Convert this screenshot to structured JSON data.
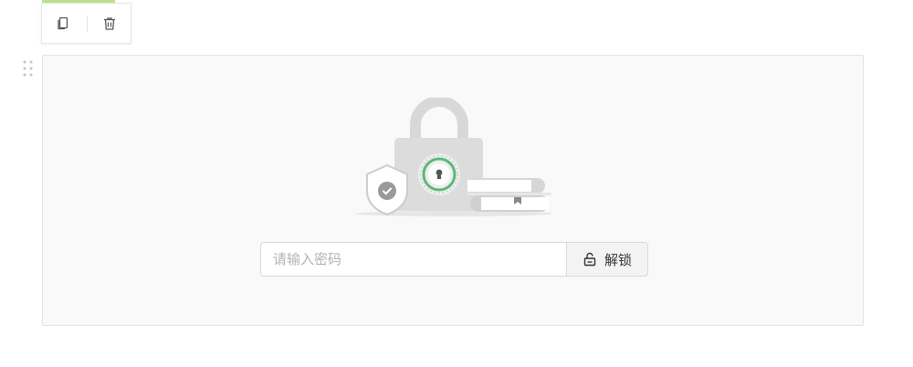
{
  "toolbar": {
    "copy_icon": "copy-icon",
    "delete_icon": "trash-icon",
    "accent_color": "#b8e28a"
  },
  "drag_handle": {
    "icon": "drag-dots-icon"
  },
  "locked_block": {
    "illustration": "padlock-shield-books",
    "accent_color": "#5cb87a",
    "password_input": {
      "placeholder": "请输入密码",
      "value": ""
    },
    "unlock_button": {
      "label": "解锁",
      "icon": "unlock-icon"
    }
  }
}
